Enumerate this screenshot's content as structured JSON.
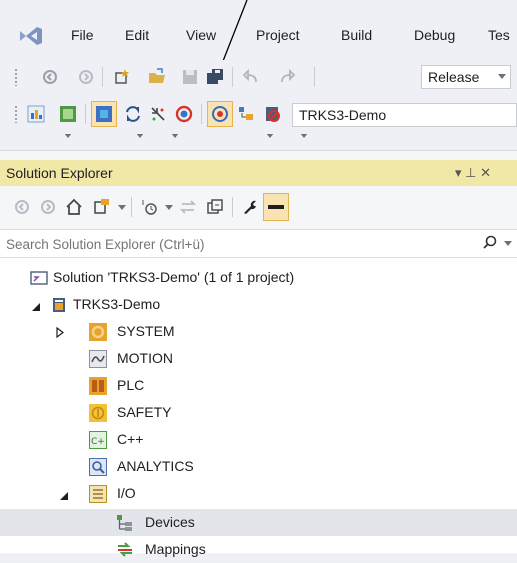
{
  "menu": {
    "items": [
      "File",
      "Edit",
      "View",
      "Project",
      "Build",
      "Debug",
      "Tes"
    ]
  },
  "toolbar": {
    "configuration": "Release",
    "target_system": "TRKS3-Demo"
  },
  "solution_explorer": {
    "title": "Solution Explorer",
    "title_pin": "▾ ⊥ ✕",
    "search_placeholder": "Search Solution Explorer (Ctrl+ü)",
    "tree": [
      {
        "label": "Solution 'TRKS3-Demo' (1 of 1 project)",
        "icon": "solution-icon",
        "level": 0,
        "expander": ""
      },
      {
        "label": "TRKS3-Demo",
        "icon": "project-icon",
        "level": 1,
        "expander": "expanded"
      },
      {
        "label": "SYSTEM",
        "icon": "gear-icon",
        "level": 2,
        "expander": "collapsed"
      },
      {
        "label": "MOTION",
        "icon": "motion-icon",
        "level": 2,
        "expander": ""
      },
      {
        "label": "PLC",
        "icon": "plc-icon",
        "level": 2,
        "expander": ""
      },
      {
        "label": "SAFETY",
        "icon": "safety-icon",
        "level": 2,
        "expander": ""
      },
      {
        "label": "C++",
        "icon": "cpp-icon",
        "level": 2,
        "expander": ""
      },
      {
        "label": "ANALYTICS",
        "icon": "analytics-icon",
        "level": 2,
        "expander": ""
      },
      {
        "label": "I/O",
        "icon": "io-icon",
        "level": 2,
        "expander": "expanded"
      },
      {
        "label": "Devices",
        "icon": "devices-icon",
        "level": 3,
        "expander": "",
        "selected": true
      },
      {
        "label": "Mappings",
        "icon": "mappings-icon",
        "level": 3,
        "expander": ""
      }
    ]
  },
  "colors": {
    "title_bar": "#f1e8a7",
    "pressed_button": "#f9e3b3",
    "background": "#eef0f5"
  }
}
